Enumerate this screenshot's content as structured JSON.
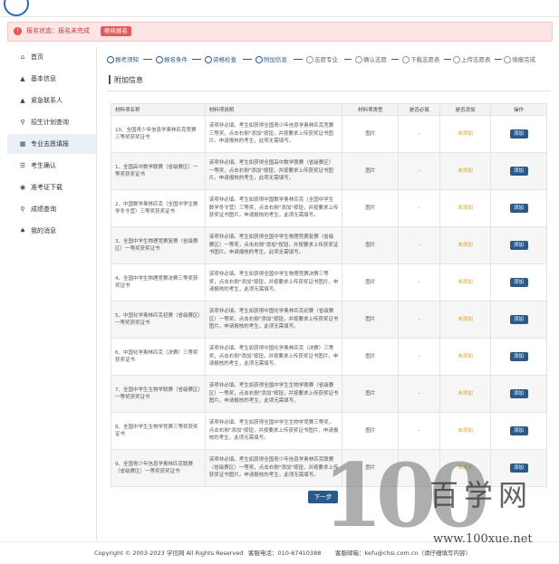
{
  "alert": {
    "status_text": "报名状态：报名未完成",
    "button": "继续报名"
  },
  "sidebar": {
    "items": [
      {
        "icon": "home-icon",
        "glyph": "⌂",
        "label": "首页"
      },
      {
        "icon": "user-icon",
        "glyph": "▲",
        "label": "基本信息"
      },
      {
        "icon": "contact-icon",
        "glyph": "▲",
        "label": "紧急联系人"
      },
      {
        "icon": "search-icon",
        "glyph": "⚲",
        "label": "招生计划查询"
      },
      {
        "icon": "list-icon",
        "glyph": "▦",
        "label": "专业志愿填报"
      },
      {
        "icon": "confirm-icon",
        "glyph": "☰",
        "label": "考生确认"
      },
      {
        "icon": "download-icon",
        "glyph": "◉",
        "label": "准考证下载"
      },
      {
        "icon": "grade-icon",
        "glyph": "⚲",
        "label": "成绩查询"
      },
      {
        "icon": "bell-icon",
        "glyph": "♠",
        "label": "我的消息"
      }
    ]
  },
  "steps": [
    {
      "n": "1",
      "label": "报考须知"
    },
    {
      "n": "2",
      "label": "报名条件"
    },
    {
      "n": "3",
      "label": "资格检查"
    },
    {
      "n": "4",
      "label": "附加信息"
    },
    {
      "n": "5",
      "label": "志愿专业"
    },
    {
      "n": "6",
      "label": "确认志愿"
    },
    {
      "n": "7",
      "label": "下载志愿表"
    },
    {
      "n": "8",
      "label": "上传志愿表"
    },
    {
      "n": "9",
      "label": "填报完成"
    }
  ],
  "section_title": "附加信息",
  "table": {
    "headers": [
      "材料项名称",
      "材料项说明",
      "材料项类型",
      "是否必填",
      "是否添加",
      "操作"
    ],
    "rows": [
      {
        "name": "10、全国青少年信息学奥林匹克竞赛三等奖获奖证书",
        "desc": "该项非必填。考生如获得全国青少年信息学奥林匹克竞赛三等奖，点击右侧\"添加\"按钮，并按要求上传获奖证书图片。申请报核的考生，此项无需填写。",
        "type": "图片",
        "required": "-",
        "added": "未添加",
        "action": "添加"
      },
      {
        "name": "1、全国高中数学联赛（省级赛区）一等奖获奖证书",
        "desc": "该项非必填。考生如获得全国高中数学联赛（省级赛区）一等奖，点击右侧\"添加\"按钮，并按要求上传获奖证书图片。申请报核的考生，此项无需填写。",
        "type": "图片",
        "required": "-",
        "added": "未添加",
        "action": "添加"
      },
      {
        "name": "2、中国数学奥林匹克（全国中学生数学冬令营）三等奖获奖证书",
        "desc": "该项非必填。考生如获得中国数学奥林匹克（全国中学生数学冬令营）三等奖，点击右侧\"添加\"按钮，并按要求上传获奖证书图片。申请报核的考生，此项无需填写。",
        "type": "图片",
        "required": "-",
        "added": "未添加",
        "action": "添加"
      },
      {
        "name": "3、全国中学生物理竞赛复赛（省级赛区）一等奖获奖证书",
        "desc": "该项非必填。考生如获得全国中学生物理竞赛复赛（省级赛区）一等奖，点击右侧\"添加\"按钮，并按要求上传获奖证书图片。申请报核的考生，此项无需填写。",
        "type": "图片",
        "required": "-",
        "added": "未添加",
        "action": "添加"
      },
      {
        "name": "4、全国中学生物理竞赛决赛三等奖获奖证书",
        "desc": "该项非必填。考生如获得全国中学生物理竞赛决赛三等奖，点击右侧\"添加\"按钮，并按要求上传获奖证书图片。申请报核的考生，此项无需填写。",
        "type": "图片",
        "required": "-",
        "added": "未添加",
        "action": "添加"
      },
      {
        "name": "5、中国化学奥林匹克初赛（省级赛区）一等奖获奖证书",
        "desc": "该项非必填。考生如获得中国化学奥林匹克初赛（省级赛区）一等奖，点击右侧\"添加\"按钮，并按要求上传获奖证书图片。申请报核的考生，此项无需填写。",
        "type": "图片",
        "required": "-",
        "added": "未添加",
        "action": "添加"
      },
      {
        "name": "6、中国化学奥林匹克（决赛）三等奖获奖证书",
        "desc": "该项非必填。考生如获得中国化学奥林匹克（决赛）三等奖，点击右侧\"添加\"按钮，并按要求上传获奖证书图片。申请报核的考生，此项无需填写。",
        "type": "图片",
        "required": "-",
        "added": "未添加",
        "action": "添加"
      },
      {
        "name": "7、全国中学生生物学联赛（省级赛区）一等奖获奖证书",
        "desc": "该项非必填。考生如获得全国中学生生物学联赛（省级赛区）一等奖，点击右侧\"添加\"按钮，并按要求上传获奖证书图片。申请报核的考生，此项无需填写。",
        "type": "图片",
        "required": "-",
        "added": "未添加",
        "action": "添加"
      },
      {
        "name": "8、全国中学生生物学竞赛三等奖获奖证书",
        "desc": "该项非必填。考生如获得全国中学生生物学竞赛三等奖，点击右侧\"添加\"按钮，并按要求上传获奖证书图片。申请报核的考生，此项无需填写。",
        "type": "图片",
        "required": "-",
        "added": "未添加",
        "action": "添加"
      },
      {
        "name": "9、全国青少年信息学奥林匹克联赛（省级赛区）一等奖获奖证书",
        "desc": "该项非必填。考生如获得全国青少年信息学奥林匹克联赛（省级赛区）一等奖，点击右侧\"添加\"按钮，并按要求上传获奖证书图片。申请报核的考生，此项无需填写。",
        "type": "图片",
        "required": "-",
        "added": "未添加",
        "action": "添加"
      }
    ]
  },
  "next_button": "下一步",
  "footer": {
    "copyright": "Copyright © 2003-2023 学信网 All Rights Reserved",
    "phone": "客服电话：010-67410388",
    "email": "客服邮箱：kefu@chsi.com.cn（请仔细填写内容）"
  },
  "watermark": {
    "big": "100",
    "cn": "百学网",
    "url": "www.100xue.net"
  }
}
